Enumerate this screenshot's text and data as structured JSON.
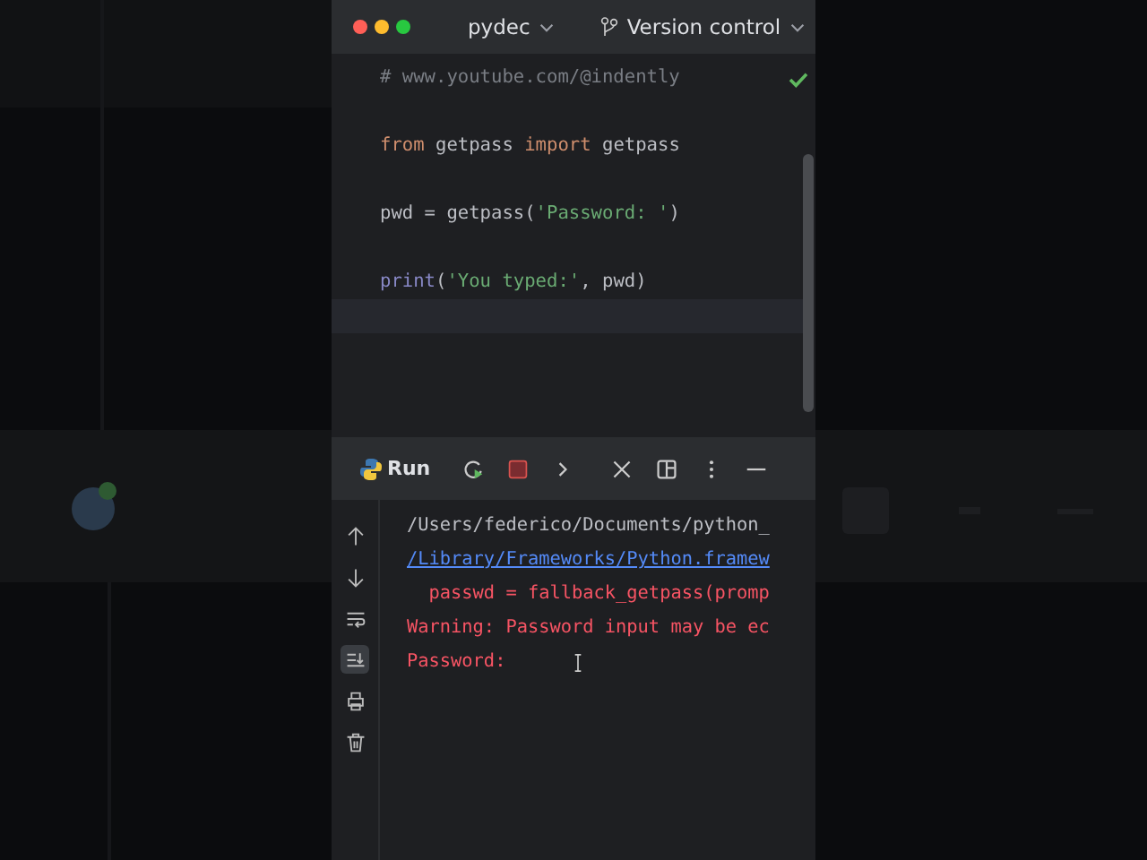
{
  "title_bar": {
    "project": "pydec",
    "vcs": "Version control"
  },
  "editor": {
    "lines": [
      {
        "kind": "code",
        "tokens": [
          {
            "kind": "comment",
            "text": "# www.youtube.com/@indently"
          }
        ]
      },
      {
        "kind": "blank"
      },
      {
        "kind": "code",
        "tokens": [
          {
            "kind": "keyword",
            "text": "from"
          },
          {
            "kind": "plain",
            "text": " getpass "
          },
          {
            "kind": "keyword",
            "text": "import"
          },
          {
            "kind": "plain",
            "text": " getpass"
          }
        ]
      },
      {
        "kind": "blank"
      },
      {
        "kind": "code",
        "tokens": [
          {
            "kind": "plain",
            "text": "pwd = getpass("
          },
          {
            "kind": "string",
            "text": "'Password: '"
          },
          {
            "kind": "plain",
            "text": ")"
          }
        ]
      },
      {
        "kind": "blank"
      },
      {
        "kind": "code",
        "tokens": [
          {
            "kind": "builtin",
            "text": "print"
          },
          {
            "kind": "plain",
            "text": "("
          },
          {
            "kind": "string",
            "text": "'You typed:'"
          },
          {
            "kind": "plain",
            "text": ", pwd)"
          }
        ]
      },
      {
        "kind": "blank",
        "current": true
      }
    ]
  },
  "run_panel": {
    "title": "Run",
    "gutter": [
      {
        "kind": "up",
        "selected": false
      },
      {
        "kind": "down",
        "selected": false
      },
      {
        "kind": "wrap",
        "selected": false
      },
      {
        "kind": "scroll-end",
        "selected": true
      },
      {
        "kind": "print",
        "selected": false
      },
      {
        "kind": "trash",
        "selected": false
      }
    ],
    "output": [
      {
        "kind": "path",
        "text": "/Users/federico/Documents/python_"
      },
      {
        "kind": "link",
        "text": "/Library/Frameworks/Python.framew"
      },
      {
        "kind": "error",
        "text": "  passwd = fallback_getpass(promp"
      },
      {
        "kind": "error",
        "text": "Warning: Password input may be ec"
      },
      {
        "kind": "error",
        "text": "Password:"
      }
    ]
  }
}
